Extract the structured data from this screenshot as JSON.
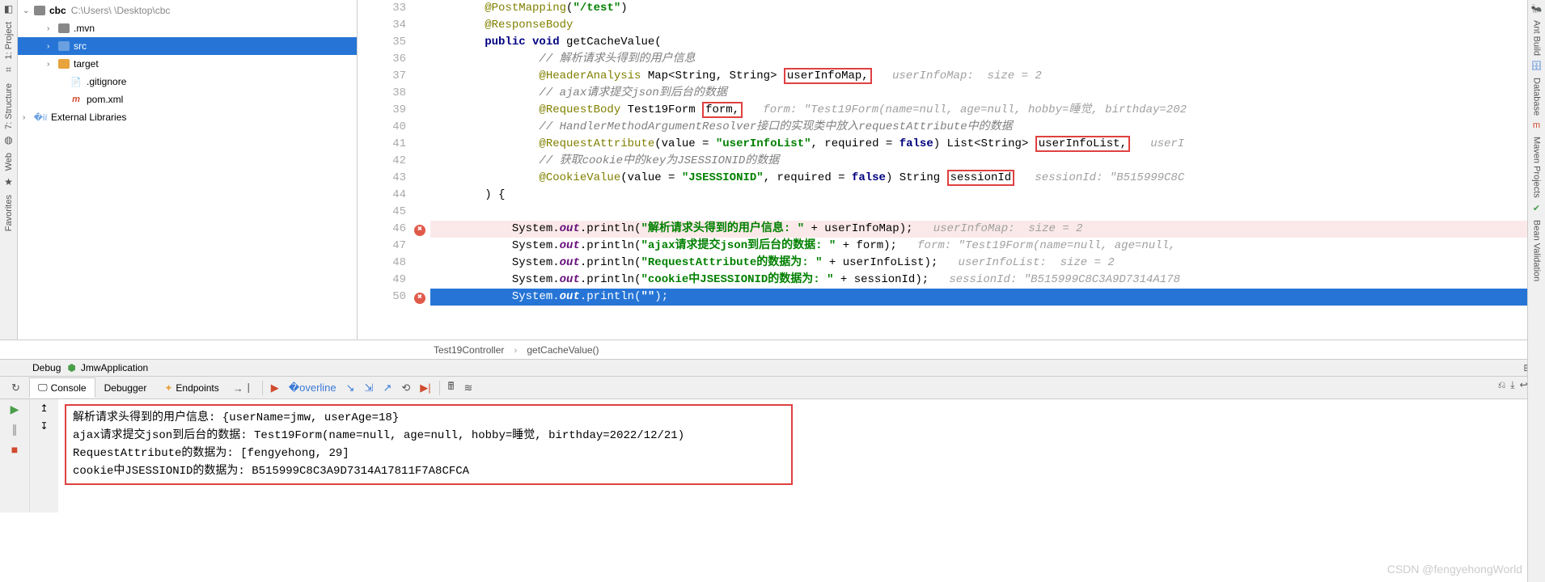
{
  "left_tools": [
    {
      "icon": "◧",
      "label": "1: Project",
      "name": "tool-project"
    },
    {
      "icon": "⌗",
      "label": "7: Structure",
      "name": "tool-structure"
    },
    {
      "icon": "◍",
      "label": "Web",
      "name": "tool-web"
    },
    {
      "icon": "★",
      "label": "Favorites",
      "name": "tool-favorites"
    }
  ],
  "right_tools": [
    {
      "icon": "🐜",
      "label": "Ant Build",
      "name": "tool-ant",
      "color": "#4a9e4a"
    },
    {
      "icon": "🗄",
      "label": "Database",
      "name": "tool-database",
      "color": "#3a7ad6"
    },
    {
      "icon": "m",
      "label": "Maven Projects",
      "name": "tool-maven",
      "color": "#d04a2e"
    },
    {
      "icon": "✔",
      "label": "Bean Validation",
      "name": "tool-bean",
      "color": "#4a9e4a"
    }
  ],
  "tree": {
    "root": {
      "name": "cbc",
      "path": "C:\\Users\\        \\Desktop\\cbc"
    },
    "children": [
      {
        "label": ".mvn",
        "icon": "folder-g",
        "indent": 30,
        "arrow": "›"
      },
      {
        "label": "src",
        "icon": "folder-b",
        "indent": 30,
        "arrow": "›",
        "selected": true
      },
      {
        "label": "target",
        "icon": "folder-o",
        "indent": 30,
        "arrow": "›"
      },
      {
        "label": ".gitignore",
        "icon": "file",
        "indent": 44,
        "arrow": ""
      },
      {
        "label": "pom.xml",
        "icon": "maven",
        "indent": 44,
        "arrow": ""
      }
    ],
    "external": "External Libraries"
  },
  "code": {
    "lines": [
      {
        "n": 33,
        "html": "@PostMapping(\"/test\")"
      },
      {
        "n": 34,
        "html": "@ResponseBody"
      },
      {
        "n": 35,
        "html": "public void getCacheValue("
      },
      {
        "n": 36,
        "html": "// 解析请求头得到的用户信息"
      },
      {
        "n": 37,
        "html": "@HeaderAnalysis Map<String, String> userInfoMap,   userInfoMap:  size = 2"
      },
      {
        "n": 38,
        "html": "// ajax请求提交json到后台的数据"
      },
      {
        "n": 39,
        "html": "@RequestBody Test19Form form,   form: \"Test19Form(name=null, age=null, hobby=睡觉, birthday=202"
      },
      {
        "n": 40,
        "html": "// HandlerMethodArgumentResolver接口的实现类中放入requestAttribute中的数据"
      },
      {
        "n": 41,
        "html": "@RequestAttribute(value = \"userInfoList\", required = false) List<String> userInfoList,   userI"
      },
      {
        "n": 42,
        "html": "// 获取cookie中的key为JSESSIONID的数据"
      },
      {
        "n": 43,
        "html": "@CookieValue(value = \"JSESSIONID\", required = false) String sessionId   sessionId: \"B515999C8C"
      },
      {
        "n": 44,
        "html": ") {"
      },
      {
        "n": 45,
        "html": ""
      },
      {
        "n": 46,
        "html": "System.out.println(\"解析请求头得到的用户信息: \" + userInfoMap);   userInfoMap:  size = 2",
        "err": true
      },
      {
        "n": 47,
        "html": "System.out.println(\"ajax请求提交json到后台的数据: \" + form);   form: \"Test19Form(name=null, age=null,"
      },
      {
        "n": 48,
        "html": "System.out.println(\"RequestAttribute的数据为: \" + userInfoList);   userInfoList:  size = 2"
      },
      {
        "n": 49,
        "html": "System.out.println(\"cookie中JSESSIONID的数据为: \" + sessionId);   sessionId: \"B515999C8C3A9D7314A178"
      },
      {
        "n": 50,
        "html": "System.out.println(\"\");",
        "caret": true,
        "err": true
      }
    ]
  },
  "crumbs": {
    "a": "Test19Controller",
    "b": "getCacheValue()"
  },
  "debug": {
    "title": "JmwApplication",
    "label": "Debug"
  },
  "tabs": {
    "console": "Console",
    "debugger": "Debugger",
    "endpoints": "Endpoints"
  },
  "console": [
    "解析请求头得到的用户信息: {userName=jmw, userAge=18}",
    "ajax请求提交json到后台的数据: Test19Form(name=null, age=null, hobby=睡觉, birthday=2022/12/21)",
    "RequestAttribute的数据为: [fengyehong, 29]",
    "cookie中JSESSIONID的数据为: B515999C8C3A9D7314A17811F7A8CFCA"
  ],
  "watermark": "CSDN @fengyehongWorld"
}
